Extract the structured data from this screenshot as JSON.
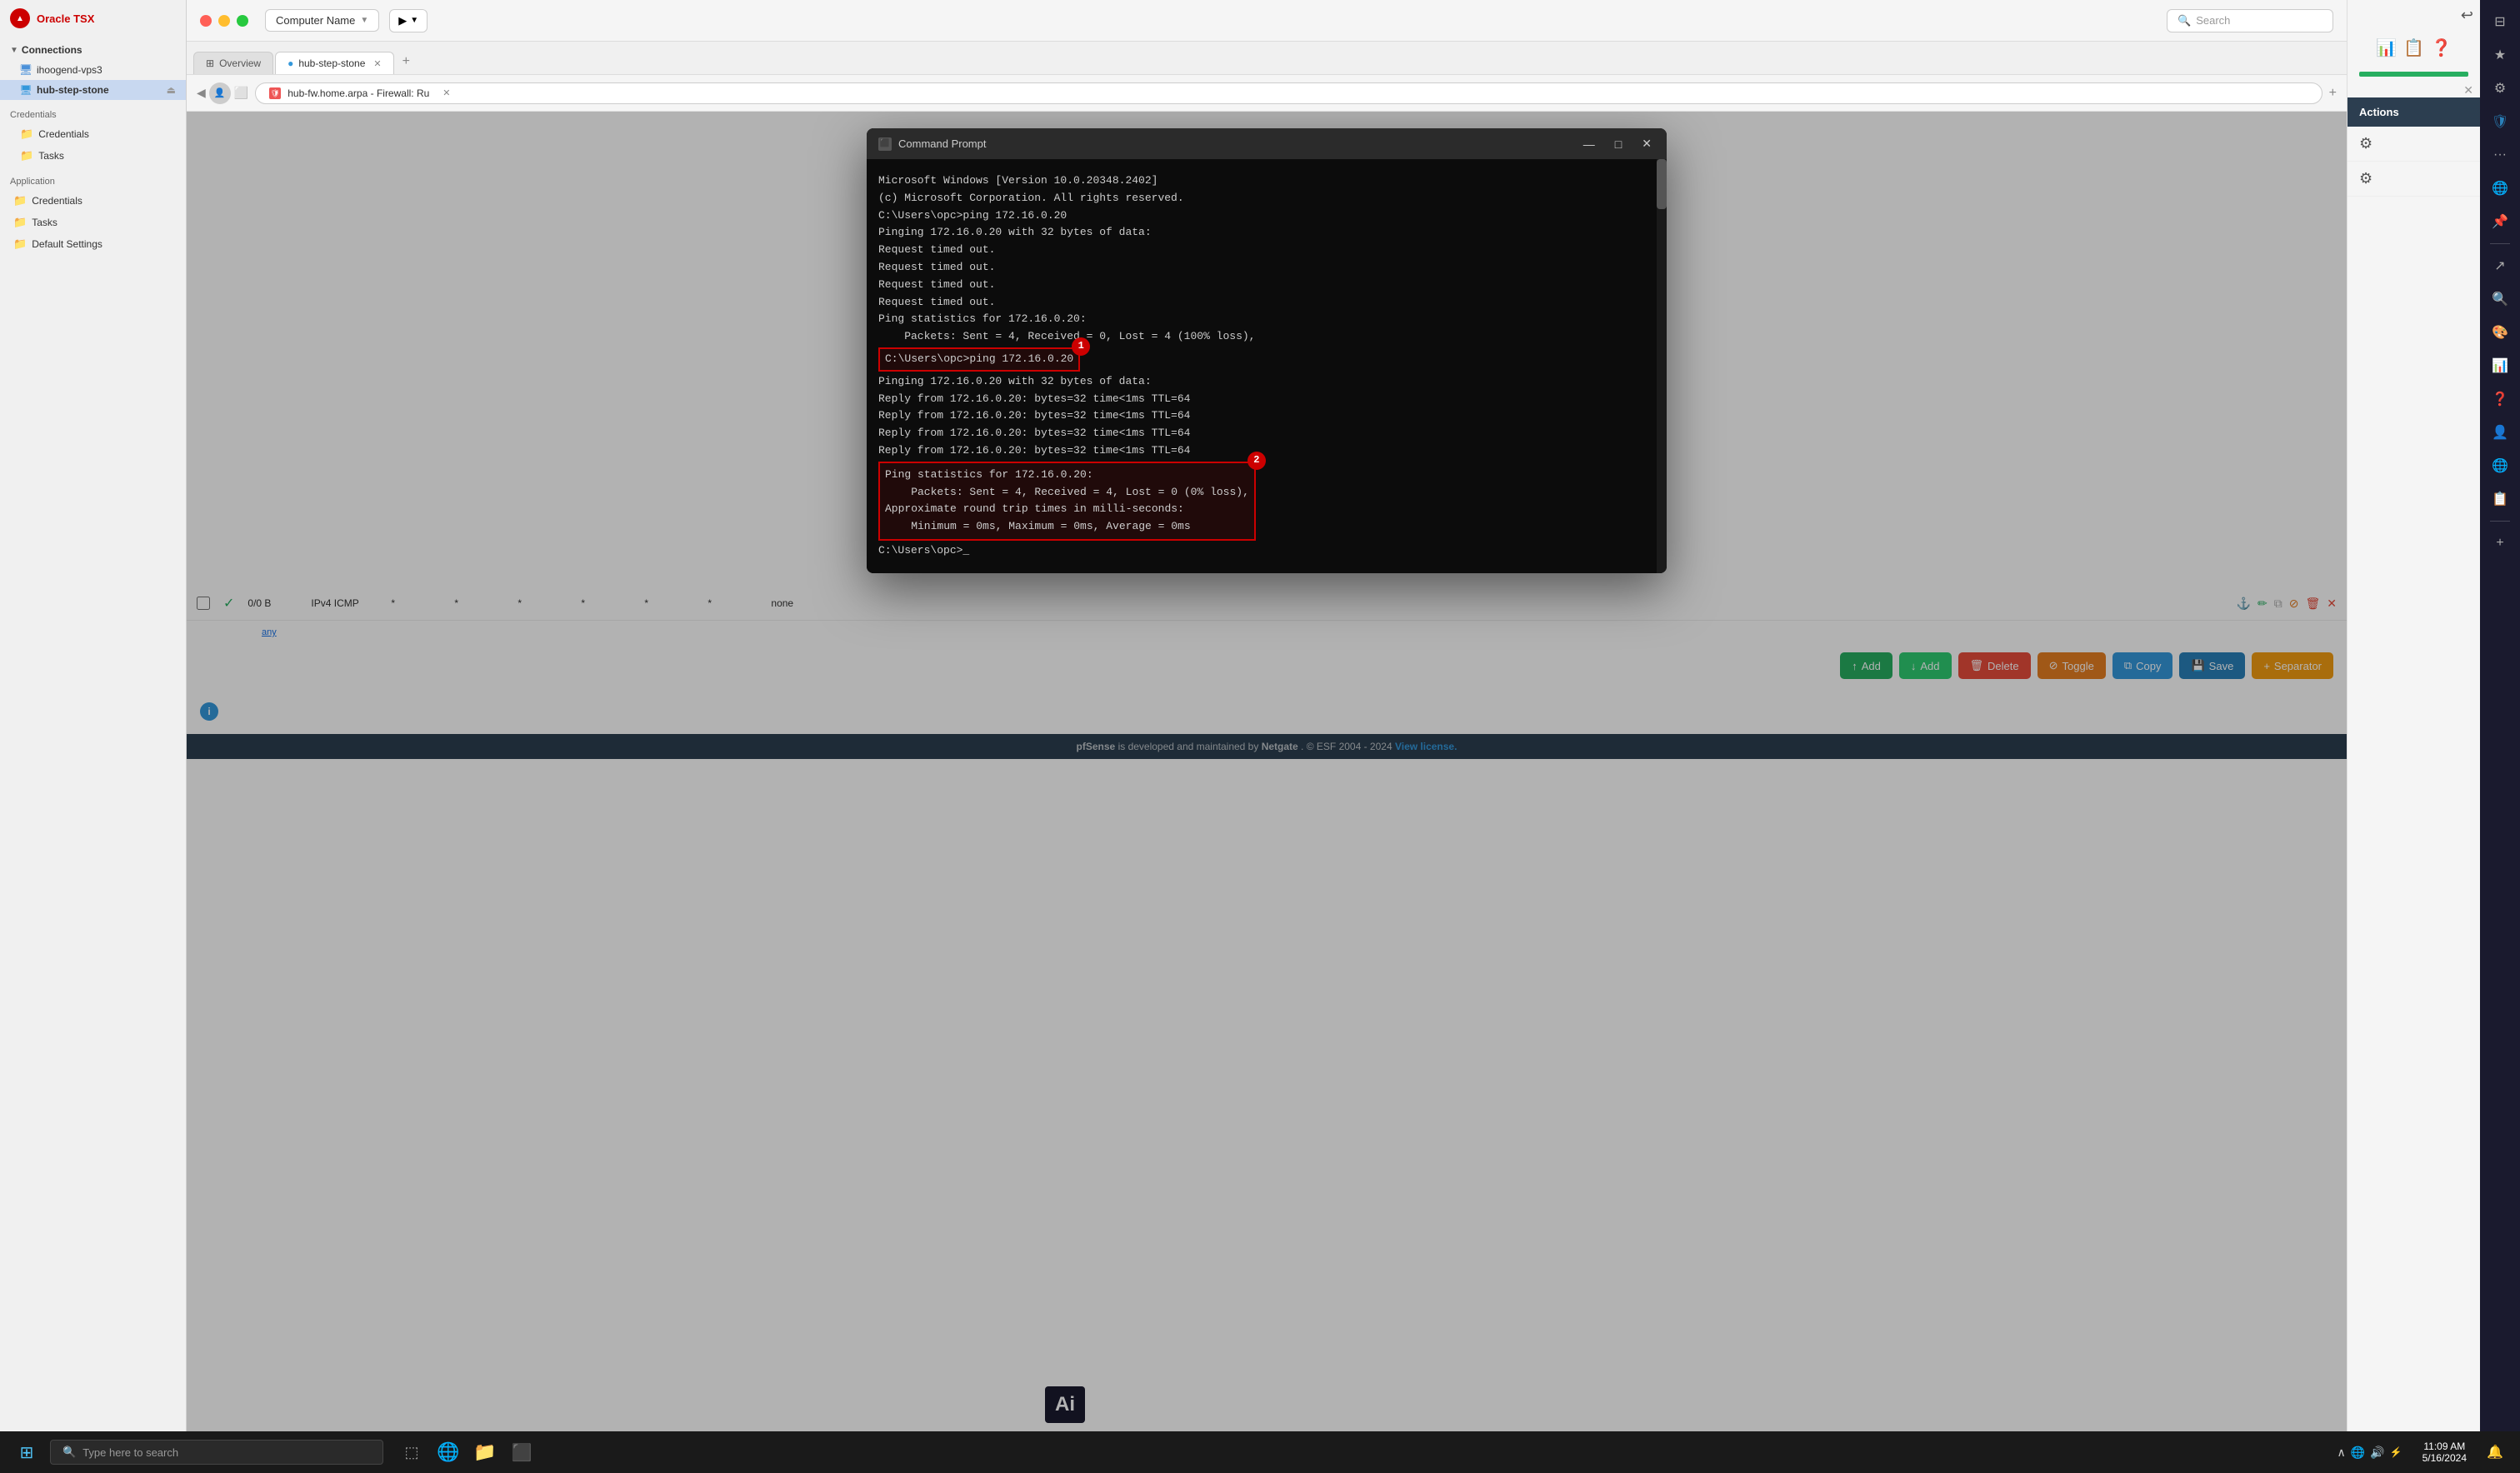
{
  "app": {
    "title": "Oracle TSX"
  },
  "sidebar": {
    "title": "Oracle TSX",
    "sections": [
      {
        "name": "Connections",
        "items": [
          {
            "label": "ihoogend-vps3",
            "type": "server",
            "active": false
          },
          {
            "label": "hub-step-stone",
            "type": "server-active",
            "active": true
          }
        ]
      },
      {
        "name": "Application",
        "items": [
          {
            "label": "Credentials",
            "type": "folder"
          },
          {
            "label": "Tasks",
            "type": "folder"
          }
        ]
      },
      {
        "label": "Credentials",
        "type": "folder"
      },
      {
        "label": "Tasks",
        "type": "folder"
      },
      {
        "label": "Default Settings",
        "type": "folder"
      }
    ]
  },
  "topbar": {
    "computer_name": "Computer Name",
    "search_placeholder": "Search"
  },
  "tabs": [
    {
      "label": "Overview",
      "icon": "grid",
      "active": false,
      "closable": false
    },
    {
      "label": "hub-step-stone",
      "icon": "server",
      "active": true,
      "closable": true
    }
  ],
  "browser": {
    "url": "hub-fw.home.arpa - Firewall: Ru",
    "favicon": "shield"
  },
  "cmd_window": {
    "title": "Command Prompt",
    "content": [
      "Microsoft Windows [Version 10.0.20348.2402]",
      "(c) Microsoft Corporation. All rights reserved.",
      "",
      "C:\\Users\\opc>ping 172.16.0.20",
      "",
      "Pinging 172.16.0.20 with 32 bytes of data:",
      "Request timed out.",
      "Request timed out.",
      "Request timed out.",
      "Request timed out.",
      "",
      "Ping statistics for 172.16.0.20:",
      "    Packets: Sent = 4, Received = 0, Lost = 4 (100% loss),",
      ""
    ],
    "highlighted_1": "C:\\Users\\opc>ping 172.16.0.20",
    "badge_1": "1",
    "highlighted_2_lines": [
      "Ping statistics for 172.16.0.20:",
      "    Packets: Sent = 4, Received = 4, Lost = 0 (0% loss),",
      "Approximate round trip times in milli-seconds:",
      "    Minimum = 0ms, Maximum = 0ms, Average = 0ms"
    ],
    "badge_2": "2",
    "second_ping_lines": [
      "C:\\Users\\opc>ping 172.16.0.20",
      "",
      "Pinging 172.16.0.20 with 32 bytes of data:",
      "Reply from 172.16.0.20: bytes=32 time<1ms TTL=64",
      "Reply from 172.16.0.20: bytes=32 time<1ms TTL=64",
      "Reply from 172.16.0.20: bytes=32 time<1ms TTL=64",
      "Reply from 172.16.0.20: bytes=32 time<1ms TTL=64"
    ],
    "prompt_end": "C:\\Users\\opc>"
  },
  "firewall": {
    "row": {
      "checkbox": false,
      "status": "enabled",
      "bytes": "0/0 B",
      "protocol": "IPv4 ICMP",
      "source": "*",
      "src_port": "*",
      "dest": "*",
      "dest_port": "*",
      "gateway": "*",
      "queue": "*",
      "schedule": "",
      "description": "none",
      "any_label": "any"
    },
    "action_buttons": [
      {
        "label": "Add",
        "icon": "↑",
        "color": "green"
      },
      {
        "label": "Add",
        "icon": "↓",
        "color": "green2"
      },
      {
        "label": "Delete",
        "icon": "🗑",
        "color": "red"
      },
      {
        "label": "Toggle",
        "icon": "⊘",
        "color": "orange"
      },
      {
        "label": "Copy",
        "icon": "⧉",
        "color": "blue"
      },
      {
        "label": "Save",
        "icon": "💾",
        "color": "darkblue"
      },
      {
        "label": "Separator",
        "icon": "+",
        "color": "yellow"
      }
    ]
  },
  "pfsense_footer": {
    "text": "pfSense is developed and maintained by Netgate. © ESF 2004 - 2024",
    "link_text": "View license.",
    "brand": "pfSense",
    "maintainer": "Netgate"
  },
  "actions_panel": {
    "title": "Actions",
    "items": [
      {
        "icon": "⚙",
        "label": ""
      },
      {
        "icon": "⚙",
        "label": ""
      }
    ]
  },
  "taskbar": {
    "search_placeholder": "Type here to search",
    "time": "11:09 AM",
    "date": "5/16/2024"
  },
  "ai_label": "Ai",
  "extensions": {
    "icons": [
      "⊞",
      "★",
      "⚙",
      "🛡",
      "...",
      "🔵",
      "📌",
      "↗",
      "🔍",
      "🎨",
      "📊",
      "❓",
      "👤",
      "🌐",
      "📋",
      "+"
    ]
  }
}
